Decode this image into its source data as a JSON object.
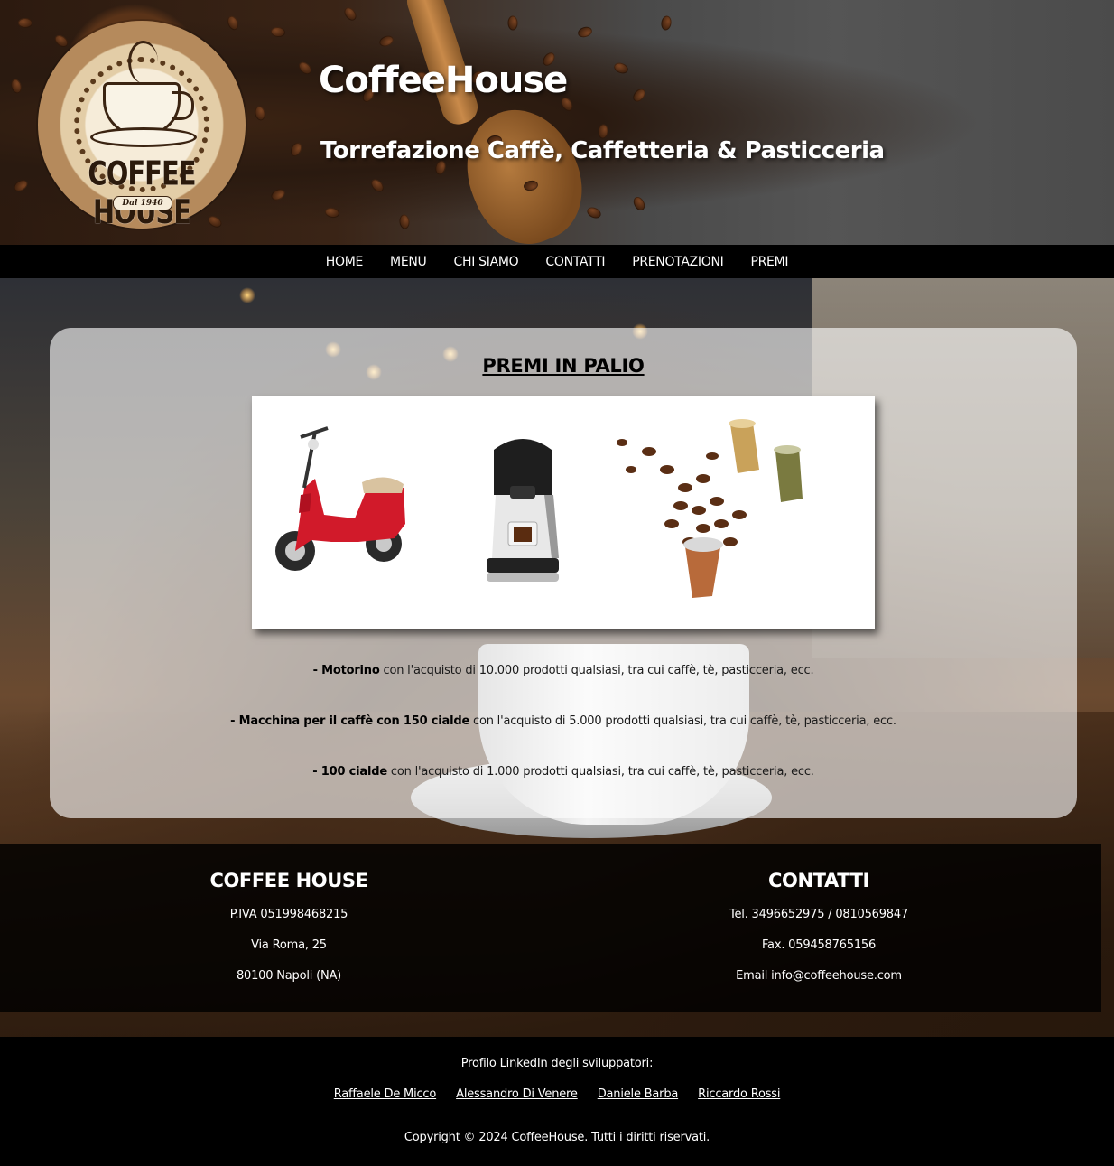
{
  "header": {
    "logo_text": "COFFEE HOUSE",
    "logo_since": "Dal 1940",
    "title": "CoffeeHouse",
    "subtitle": "Torrefazione Caffè, Caffetteria & Pasticceria"
  },
  "nav": {
    "items": [
      "HOME",
      "MENU",
      "CHI SIAMO",
      "CONTATTI",
      "PRENOTAZIONI",
      "PREMI"
    ]
  },
  "main": {
    "title": "PREMI IN PALIO",
    "prizes": [
      {
        "name": "- Motorino",
        "description": " con l'acquisto di 10.000 prodotti qualsiasi, tra cui caffè, tè, pasticceria, ecc."
      },
      {
        "name": "- Macchina per il caffè con 150 cialde",
        "description": " con l'acquisto di 5.000 prodotti qualsiasi, tra cui caffè, tè, pasticceria, ecc."
      },
      {
        "name": "- 100 cialde",
        "description": " con l'acquisto di 1.000 prodotti qualsiasi, tra cui caffè, tè, pasticceria, ecc."
      }
    ]
  },
  "info": {
    "company": {
      "heading": "COFFEE HOUSE",
      "lines": [
        "P.IVA 051998468215",
        "Via Roma, 25",
        "80100 Napoli (NA)"
      ]
    },
    "contacts": {
      "heading": "CONTATTI",
      "lines": [
        "Tel. 3496652975 / 0810569847",
        "Fax. 059458765156",
        "Email info@coffeehouse.com"
      ]
    }
  },
  "footer": {
    "label": "Profilo LinkedIn degli sviluppatori:",
    "developers": [
      "Raffaele De Micco",
      "Alessandro Di Venere",
      "Daniele Barba",
      "Riccardo Rossi"
    ],
    "copyright": "Copyright © 2024 CoffeeHouse. Tutti i diritti riservati."
  }
}
